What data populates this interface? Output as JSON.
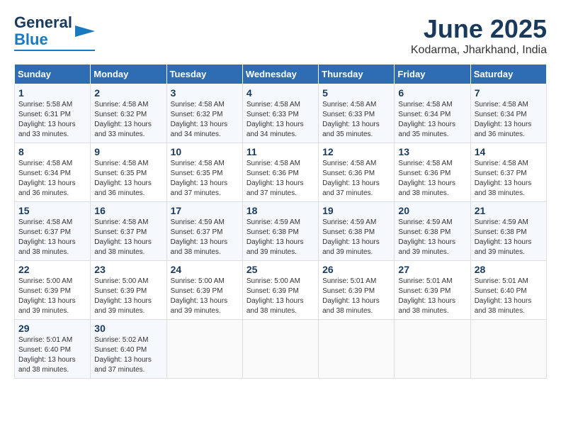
{
  "logo": {
    "line1": "General",
    "line2": "Blue"
  },
  "title": "June 2025",
  "location": "Kodarma, Jharkhand, India",
  "headers": [
    "Sunday",
    "Monday",
    "Tuesday",
    "Wednesday",
    "Thursday",
    "Friday",
    "Saturday"
  ],
  "weeks": [
    [
      {
        "day": "1",
        "rise": "5:58 AM",
        "set": "6:31 PM",
        "hours": "13 hours",
        "mins": "33 minutes."
      },
      {
        "day": "2",
        "rise": "4:58 AM",
        "set": "6:32 PM",
        "hours": "13 hours",
        "mins": "33 minutes."
      },
      {
        "day": "3",
        "rise": "4:58 AM",
        "set": "6:32 PM",
        "hours": "13 hours",
        "mins": "34 minutes."
      },
      {
        "day": "4",
        "rise": "4:58 AM",
        "set": "6:33 PM",
        "hours": "13 hours",
        "mins": "34 minutes."
      },
      {
        "day": "5",
        "rise": "4:58 AM",
        "set": "6:33 PM",
        "hours": "13 hours",
        "mins": "35 minutes."
      },
      {
        "day": "6",
        "rise": "4:58 AM",
        "set": "6:34 PM",
        "hours": "13 hours",
        "mins": "35 minutes."
      },
      {
        "day": "7",
        "rise": "4:58 AM",
        "set": "6:34 PM",
        "hours": "13 hours",
        "mins": "36 minutes."
      }
    ],
    [
      {
        "day": "8",
        "rise": "4:58 AM",
        "set": "6:34 PM",
        "hours": "13 hours",
        "mins": "36 minutes."
      },
      {
        "day": "9",
        "rise": "4:58 AM",
        "set": "6:35 PM",
        "hours": "13 hours",
        "mins": "36 minutes."
      },
      {
        "day": "10",
        "rise": "4:58 AM",
        "set": "6:35 PM",
        "hours": "13 hours",
        "mins": "37 minutes."
      },
      {
        "day": "11",
        "rise": "4:58 AM",
        "set": "6:36 PM",
        "hours": "13 hours",
        "mins": "37 minutes."
      },
      {
        "day": "12",
        "rise": "4:58 AM",
        "set": "6:36 PM",
        "hours": "13 hours",
        "mins": "37 minutes."
      },
      {
        "day": "13",
        "rise": "4:58 AM",
        "set": "6:36 PM",
        "hours": "13 hours",
        "mins": "38 minutes."
      },
      {
        "day": "14",
        "rise": "4:58 AM",
        "set": "6:37 PM",
        "hours": "13 hours",
        "mins": "38 minutes."
      }
    ],
    [
      {
        "day": "15",
        "rise": "4:58 AM",
        "set": "6:37 PM",
        "hours": "13 hours",
        "mins": "38 minutes."
      },
      {
        "day": "16",
        "rise": "4:58 AM",
        "set": "6:37 PM",
        "hours": "13 hours",
        "mins": "38 minutes."
      },
      {
        "day": "17",
        "rise": "4:59 AM",
        "set": "6:37 PM",
        "hours": "13 hours",
        "mins": "38 minutes."
      },
      {
        "day": "18",
        "rise": "4:59 AM",
        "set": "6:38 PM",
        "hours": "13 hours",
        "mins": "39 minutes."
      },
      {
        "day": "19",
        "rise": "4:59 AM",
        "set": "6:38 PM",
        "hours": "13 hours",
        "mins": "39 minutes."
      },
      {
        "day": "20",
        "rise": "4:59 AM",
        "set": "6:38 PM",
        "hours": "13 hours",
        "mins": "39 minutes."
      },
      {
        "day": "21",
        "rise": "4:59 AM",
        "set": "6:38 PM",
        "hours": "13 hours",
        "mins": "39 minutes."
      }
    ],
    [
      {
        "day": "22",
        "rise": "5:00 AM",
        "set": "6:39 PM",
        "hours": "13 hours",
        "mins": "39 minutes."
      },
      {
        "day": "23",
        "rise": "5:00 AM",
        "set": "6:39 PM",
        "hours": "13 hours",
        "mins": "39 minutes."
      },
      {
        "day": "24",
        "rise": "5:00 AM",
        "set": "6:39 PM",
        "hours": "13 hours",
        "mins": "39 minutes."
      },
      {
        "day": "25",
        "rise": "5:00 AM",
        "set": "6:39 PM",
        "hours": "13 hours",
        "mins": "38 minutes."
      },
      {
        "day": "26",
        "rise": "5:01 AM",
        "set": "6:39 PM",
        "hours": "13 hours",
        "mins": "38 minutes."
      },
      {
        "day": "27",
        "rise": "5:01 AM",
        "set": "6:39 PM",
        "hours": "13 hours",
        "mins": "38 minutes."
      },
      {
        "day": "28",
        "rise": "5:01 AM",
        "set": "6:40 PM",
        "hours": "13 hours",
        "mins": "38 minutes."
      }
    ],
    [
      {
        "day": "29",
        "rise": "5:01 AM",
        "set": "6:40 PM",
        "hours": "13 hours",
        "mins": "38 minutes."
      },
      {
        "day": "30",
        "rise": "5:02 AM",
        "set": "6:40 PM",
        "hours": "13 hours",
        "mins": "37 minutes."
      },
      null,
      null,
      null,
      null,
      null
    ]
  ]
}
